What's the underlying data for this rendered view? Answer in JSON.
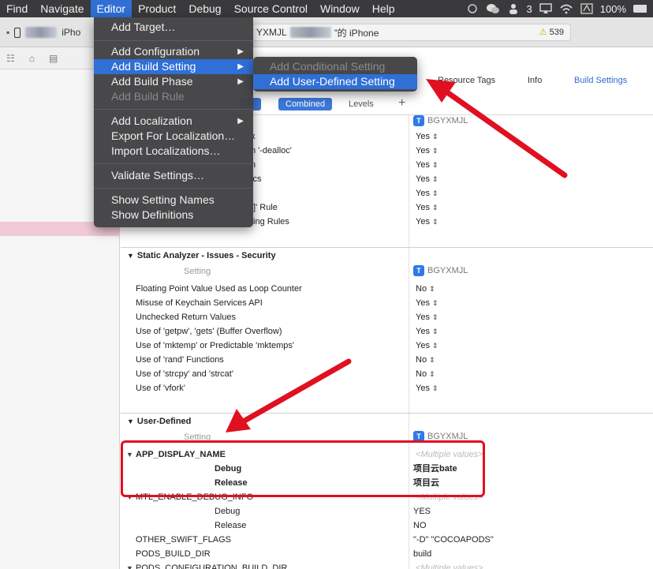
{
  "menubar": {
    "items": [
      "Find",
      "Navigate",
      "Editor",
      "Product",
      "Debug",
      "Source Control",
      "Window",
      "Help"
    ],
    "badge_count": "3",
    "battery": "100%"
  },
  "toolbar": {
    "scheme_device": "iPho",
    "status_text": "YXMJL",
    "status_suffix": "”的 iPhone",
    "warning_count": "539"
  },
  "editor_menu": {
    "add_target": "Add Target…",
    "add_configuration": "Add Configuration",
    "add_build_setting": "Add Build Setting",
    "add_build_phase": "Add Build Phase",
    "add_build_rule": "Add Build Rule",
    "add_localization": "Add Localization",
    "export_localization": "Export For Localization…",
    "import_localizations": "Import Localizations…",
    "validate_settings": "Validate Settings…",
    "show_setting_names": "Show Setting Names",
    "show_definitions": "Show Definitions"
  },
  "submenu": {
    "add_conditional": "Add Conditional Setting",
    "add_user_defined": "Add User-Defined Setting"
  },
  "tabs": {
    "resource_tags": "Resource Tags",
    "info": "Info",
    "build_settings": "Build Settings"
  },
  "filter": {
    "combined": "Combined",
    "levels": "Levels"
  },
  "target_name": "BGYXMJL",
  "setting_col": "Setting",
  "top_rows": [
    {
      "name": "x",
      "value": "Yes"
    },
    {
      "name": "n '-dealloc'",
      "value": "Yes"
    },
    {
      "name": "n",
      "value": "Yes"
    },
    {
      "name": "ics",
      "value": "Yes"
    },
    {
      "name": "",
      "value": "Yes"
    },
    {
      "name": "t]' Rule",
      "value": "Yes"
    },
    {
      "name": "ting Rules",
      "value": "Yes"
    }
  ],
  "static_analyzer": {
    "title": "Static Analyzer - Issues - Security",
    "rows": [
      {
        "name": "Floating Point Value Used as Loop Counter",
        "value": "No"
      },
      {
        "name": "Misuse of Keychain Services API",
        "value": "Yes"
      },
      {
        "name": "Unchecked Return Values",
        "value": "Yes"
      },
      {
        "name": "Use of 'getpw', 'gets' (Buffer Overflow)",
        "value": "Yes"
      },
      {
        "name": "Use of 'mktemp' or Predictable 'mktemps'",
        "value": "Yes"
      },
      {
        "name": "Use of 'rand' Functions",
        "value": "No"
      },
      {
        "name": "Use of 'strcpy' and 'strcat'",
        "value": "No"
      },
      {
        "name": "Use of 'vfork'",
        "value": "Yes"
      }
    ]
  },
  "user_defined": {
    "title": "User-Defined",
    "app_display_name": "APP_DISPLAY_NAME",
    "multiple_values": "<Multiple values>",
    "debug": "Debug",
    "release": "Release",
    "debug_value": "项目云bate",
    "release_value": "项目云",
    "mtl_name": "MTL_ENABLE_DEBUG_INFO",
    "mtl_debug": "YES",
    "mtl_release": "NO",
    "other_swift_flags": "OTHER_SWIFT_FLAGS",
    "other_swift_value": " \"-D\" \"COCOAPODS\"",
    "pods_build_dir": "PODS_BUILD_DIR",
    "pods_build_value": "build",
    "pods_config_dir": "PODS_CONFIGURATION_BUILD_DIR"
  },
  "colors": {
    "accent": "#2f6fd6",
    "annotation_red": "#e01020",
    "selection_pink": "#f2c9d6"
  }
}
